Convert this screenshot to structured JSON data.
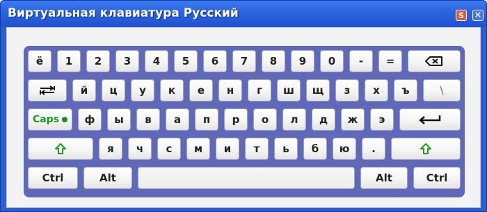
{
  "window": {
    "title": "Виртуальная клавиатура Русский",
    "buttons": {
      "settings": "S",
      "close": "✕"
    }
  },
  "colors": {
    "titlebar": "#2a62de",
    "keyboard_bg": "#5f69b8",
    "accent_green": "#1c9a1c"
  },
  "keyboard": {
    "row1": [
      "ё",
      "1",
      "2",
      "3",
      "4",
      "5",
      "6",
      "7",
      "8",
      "9",
      "0",
      "-",
      "="
    ],
    "row2": [
      "й",
      "ц",
      "у",
      "к",
      "е",
      "н",
      "г",
      "ш",
      "щ",
      "з",
      "х",
      "ъ",
      "\\"
    ],
    "row3": [
      "ф",
      "ы",
      "в",
      "а",
      "п",
      "р",
      "о",
      "л",
      "д",
      "ж",
      "э"
    ],
    "row4": [
      "я",
      "ч",
      "с",
      "м",
      "и",
      "т",
      "ь",
      "б",
      "ю",
      "."
    ],
    "caps": "Caps",
    "ctrl_left": "Ctrl",
    "alt_left": "Alt",
    "alt_right": "Alt",
    "ctrl_right": "Ctrl",
    "icons": {
      "backspace": "backspace-icon",
      "tab": "tab-icon",
      "enter": "enter-icon",
      "shift": "shift-icon",
      "caps_indicator": "caps-indicator-icon"
    }
  }
}
